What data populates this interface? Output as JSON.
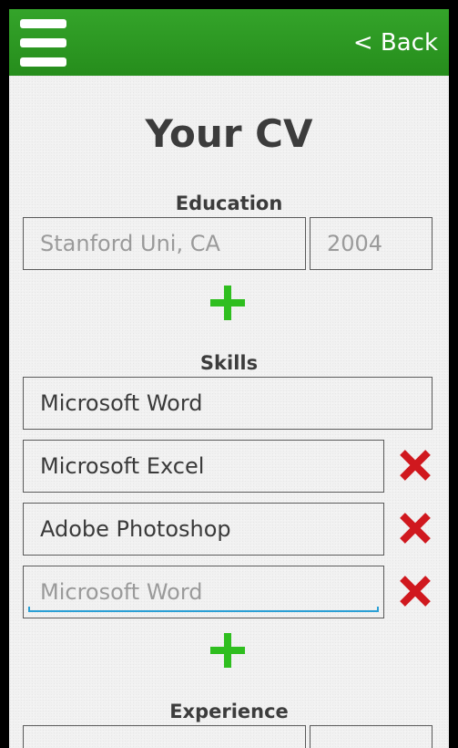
{
  "header": {
    "back_label": "< Back",
    "menu_icon": "hamburger-menu-icon",
    "accent_color": "#2b9620"
  },
  "title": "Your CV",
  "education": {
    "label": "Education",
    "school_placeholder": "Stanford Uni, CA",
    "year_placeholder": "2004",
    "add_icon": "plus-icon"
  },
  "skills": {
    "label": "Skills",
    "items": [
      {
        "value": "Microsoft Word"
      },
      {
        "value": "Microsoft Excel"
      },
      {
        "value": "Adobe Photoshop"
      }
    ],
    "new_item_placeholder": "Microsoft Word",
    "add_icon": "plus-icon",
    "remove_icon": "red-x-icon"
  },
  "experience": {
    "label": "Experience"
  },
  "colors": {
    "add": "#2fbe1f",
    "remove": "#d0181e",
    "focus": "#2aa0d6"
  }
}
